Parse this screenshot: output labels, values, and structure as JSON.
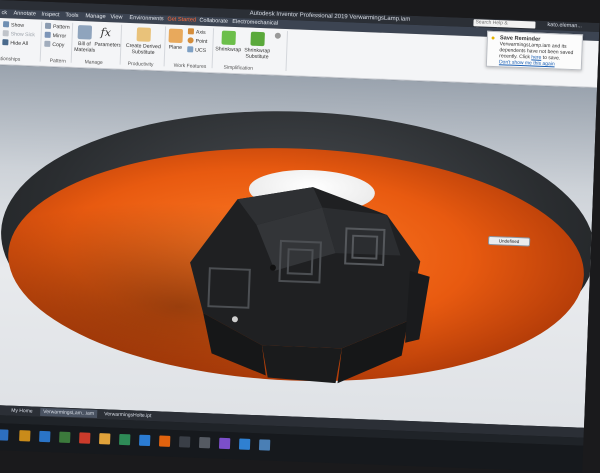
{
  "window": {
    "title": "Autodesk Inventor Professional 2019   VerwarmingsLamp.iam",
    "search_placeholder": "Search Help & Commands...",
    "user": "kato.eleman..."
  },
  "tabs": [
    "ck",
    "Annotate",
    "Inspect",
    "Tools",
    "Manage",
    "View",
    "Environments",
    "Get Started",
    "Collaborate",
    "Electromechanical"
  ],
  "active_tab": "Get Started",
  "ribbon": {
    "show": "Show",
    "show_sick": "Show Sick",
    "hide_all": "Hide All",
    "pattern": "Pattern",
    "mirror": "Mirror",
    "copy": "Copy",
    "bill_of_materials": "Bill of Materials",
    "parameters": "Parameters",
    "create_derived": "Create Derived Substitute",
    "plane": "Plane",
    "axis": "Axis",
    "point": "Point",
    "ucs": "UCS",
    "shrinkwrap": "Shrinkwrap",
    "shrinkwrap_substitute": "Shrinkwrap Substitute",
    "panels": {
      "relationships": "ationships",
      "pattern": "Pattern",
      "manage": "Manage",
      "productivity": "Productivity",
      "work_features": "Work Features",
      "simplification": "Simplification"
    }
  },
  "notification": {
    "title": "Save Reminder",
    "body": "VerwarmingsLamp.iam and its dependents have not been saved recently. Click",
    "link_here": "here",
    "body_end": "to save.",
    "dont_show": "Don't show me this again"
  },
  "viewport": {
    "mini_toolbar_label": "Undefined"
  },
  "doc_tabs": {
    "home": "My Home",
    "lamp": "VerwarmingsLam...iam",
    "part": "VerwarmingsHolte.ipt"
  },
  "colors": {
    "accent": "#ff6a3a",
    "lamp_inner": "#e85a10",
    "lamp_outer": "#2a2d30"
  }
}
